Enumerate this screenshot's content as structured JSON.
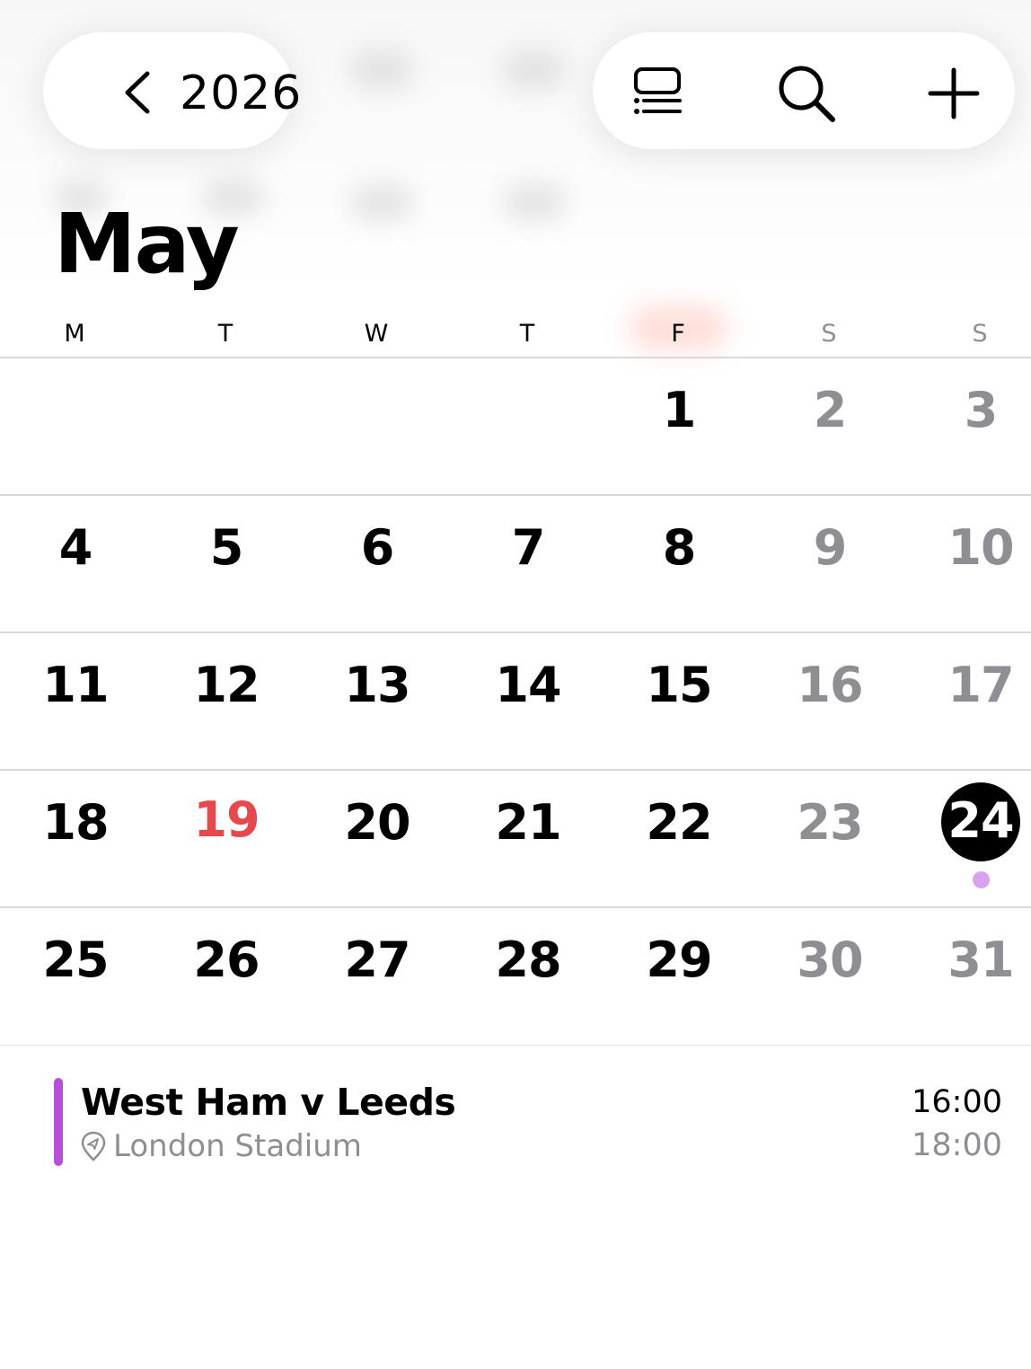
{
  "header": {
    "back_label": "2026",
    "actions": [
      {
        "icon": "list-view-icon"
      },
      {
        "icon": "search-icon"
      },
      {
        "icon": "plus-icon"
      }
    ]
  },
  "month": {
    "title": "May",
    "weekdays": [
      "M",
      "T",
      "W",
      "T",
      "F",
      "S",
      "S"
    ],
    "weeks": [
      [
        "",
        "",
        "",
        "",
        "1",
        "2",
        "3"
      ],
      [
        "4",
        "5",
        "6",
        "7",
        "8",
        "9",
        "10"
      ],
      [
        "11",
        "12",
        "13",
        "14",
        "15",
        "16",
        "17"
      ],
      [
        "18",
        "19",
        "20",
        "21",
        "22",
        "23",
        "24"
      ],
      [
        "25",
        "26",
        "27",
        "28",
        "29",
        "30",
        "31"
      ]
    ],
    "today": "24",
    "holiday": "19"
  },
  "event": {
    "title": "West Ham v Leeds",
    "location": "London Stadium",
    "start_time": "16:00",
    "end_time": "18:00",
    "color": "#b84fd8"
  },
  "colors": {
    "weekend_text": "#8e8e93",
    "holiday_text": "#e5484d",
    "today_bg": "#000000",
    "event_dot": "#d9a2ee"
  }
}
